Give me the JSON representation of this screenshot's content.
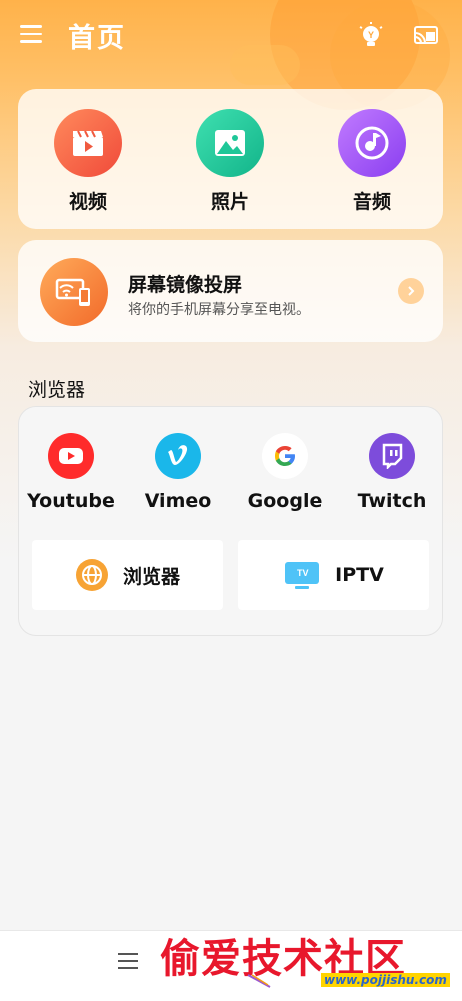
{
  "app": {
    "title": "首页"
  },
  "media": [
    {
      "label": "视频",
      "icon": "video-clapper-icon"
    },
    {
      "label": "照片",
      "icon": "photo-icon"
    },
    {
      "label": "音频",
      "icon": "music-note-icon"
    }
  ],
  "cast": {
    "title": "屏幕镜像投屏",
    "subtitle": "将你的手机屏幕分享至电视。",
    "icon": "screen-mirror-icon"
  },
  "browser_section": {
    "title": "浏览器",
    "sites": [
      {
        "label": "Youtube",
        "icon": "youtube-icon",
        "color": "#ff2b2b"
      },
      {
        "label": "Vimeo",
        "icon": "vimeo-icon",
        "color": "#1ab7ea"
      },
      {
        "label": "Google",
        "icon": "google-icon",
        "color": "#4285f4"
      },
      {
        "label": "Twitch",
        "icon": "twitch-icon",
        "color": "#7d4cdb"
      }
    ],
    "tiles": [
      {
        "label": "浏览器",
        "icon": "globe-icon"
      },
      {
        "label": "IPTV",
        "icon": "tv-icon"
      }
    ]
  },
  "watermark": {
    "text": "偷爱技术社区",
    "url": "www.pojjishu.com"
  },
  "colors": {
    "accent_orange": "#ffb24a",
    "youtube_red": "#ff2b2b",
    "vimeo_blue": "#1ab7ea",
    "twitch_purple": "#7d4cdb"
  }
}
